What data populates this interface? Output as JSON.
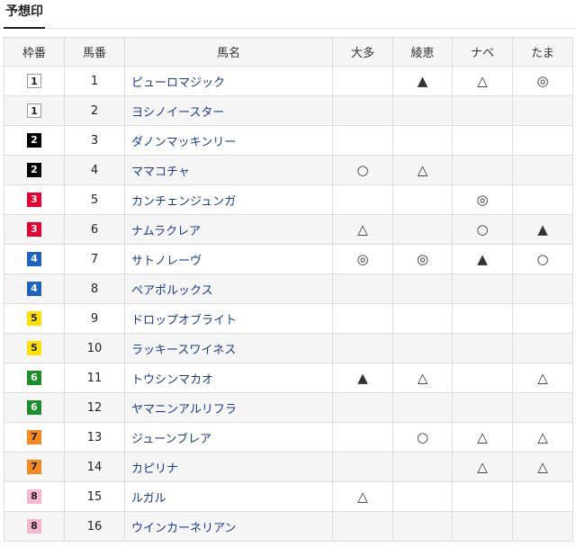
{
  "page": {
    "title": "予想印"
  },
  "table": {
    "headers": [
      "枠番",
      "馬番",
      "馬名",
      "大多",
      "綾恵",
      "ナベ",
      "たま"
    ],
    "rows": [
      {
        "waku": "1",
        "umaban": "1",
        "name": "ピューロマジック",
        "marks": [
          "",
          "▲",
          "△",
          "◎"
        ]
      },
      {
        "waku": "1",
        "umaban": "2",
        "name": "ヨシノイースター",
        "marks": [
          "",
          "",
          "",
          ""
        ]
      },
      {
        "waku": "2",
        "umaban": "3",
        "name": "ダノンマッキンリー",
        "marks": [
          "",
          "",
          "",
          ""
        ]
      },
      {
        "waku": "2",
        "umaban": "4",
        "name": "ママコチャ",
        "marks": [
          "○",
          "△",
          "",
          ""
        ]
      },
      {
        "waku": "3",
        "umaban": "5",
        "name": "カンチェンジュンガ",
        "marks": [
          "",
          "",
          "◎",
          ""
        ]
      },
      {
        "waku": "3",
        "umaban": "6",
        "name": "ナムラクレア",
        "marks": [
          "△",
          "",
          "○",
          "▲"
        ]
      },
      {
        "waku": "4",
        "umaban": "7",
        "name": "サトノレーヴ",
        "marks": [
          "◎",
          "◎",
          "▲",
          "○"
        ]
      },
      {
        "waku": "4",
        "umaban": "8",
        "name": "ペアポルックス",
        "marks": [
          "",
          "",
          "",
          ""
        ]
      },
      {
        "waku": "5",
        "umaban": "9",
        "name": "ドロップオブライト",
        "marks": [
          "",
          "",
          "",
          ""
        ]
      },
      {
        "waku": "5",
        "umaban": "10",
        "name": "ラッキースワイネス",
        "marks": [
          "",
          "",
          "",
          ""
        ]
      },
      {
        "waku": "6",
        "umaban": "11",
        "name": "トウシンマカオ",
        "marks": [
          "▲",
          "△",
          "",
          "△"
        ]
      },
      {
        "waku": "6",
        "umaban": "12",
        "name": "ヤマニンアルリフラ",
        "marks": [
          "",
          "",
          "",
          ""
        ]
      },
      {
        "waku": "7",
        "umaban": "13",
        "name": "ジューンブレア",
        "marks": [
          "",
          "○",
          "△",
          "△"
        ]
      },
      {
        "waku": "7",
        "umaban": "14",
        "name": "カピリナ",
        "marks": [
          "",
          "",
          "△",
          "△"
        ]
      },
      {
        "waku": "8",
        "umaban": "15",
        "name": "ルガル",
        "marks": [
          "△",
          "",
          "",
          ""
        ]
      },
      {
        "waku": "8",
        "umaban": "16",
        "name": "ウインカーネリアン",
        "marks": [
          "",
          "",
          "",
          ""
        ]
      }
    ]
  },
  "colors": {
    "waku_1": "#ffffff",
    "waku_2": "#000000",
    "waku_3": "#e6002d",
    "waku_4": "#1e63c4",
    "waku_5": "#ffe100",
    "waku_6": "#1a8f2a",
    "waku_7": "#f78a1e",
    "waku_8": "#f7b6d0",
    "link": "#1a3d8f"
  }
}
